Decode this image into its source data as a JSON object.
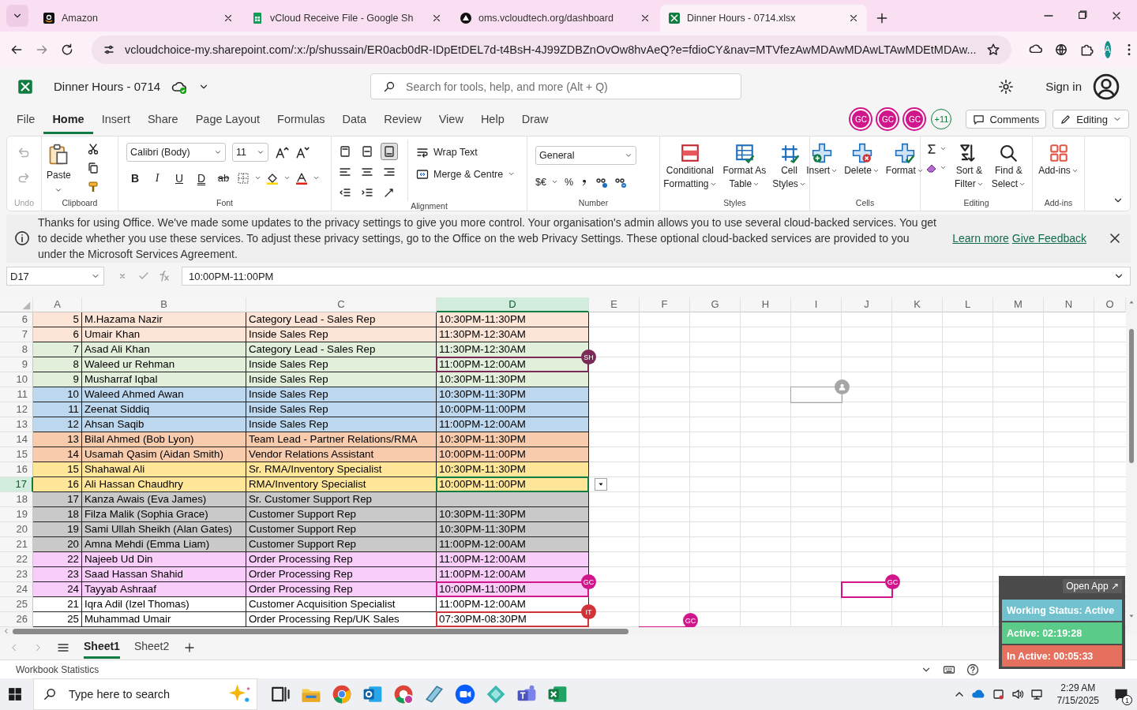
{
  "browser": {
    "tabs": [
      {
        "title": "Amazon",
        "kind": "amazon",
        "selected": false
      },
      {
        "title": "vCloud Receive File - Google Sh",
        "kind": "sheets",
        "selected": false
      },
      {
        "title": "oms.vcloudtech.org/dashboard",
        "kind": "triangle",
        "selected": false
      },
      {
        "title": "Dinner Hours - 0714.xlsx",
        "kind": "excel",
        "selected": true
      }
    ],
    "url": "vcloudchoice-my.sharepoint.com/:x:/p/shussain/ER0acb0dR-IDpEtDEL7d-t4BsH-4J99ZDBZnOvOw8hvAeQ?e=fdioCY&nav=MTVfezAwMDAwMDAwLTAwMDEtMDAw...",
    "profile": "A"
  },
  "app": {
    "title": "Dinner Hours - 0714",
    "search_placeholder": "Search for tools, help, and more (Alt + Q)",
    "sign_in": "Sign in"
  },
  "menu": [
    {
      "label": "File",
      "selected": false
    },
    {
      "label": "Home",
      "selected": true
    },
    {
      "label": "Insert",
      "selected": false
    },
    {
      "label": "Share",
      "selected": false
    },
    {
      "label": "Page Layout",
      "selected": false
    },
    {
      "label": "Formulas",
      "selected": false
    },
    {
      "label": "Data",
      "selected": false
    },
    {
      "label": "Review",
      "selected": false
    },
    {
      "label": "View",
      "selected": false
    },
    {
      "label": "Help",
      "selected": false
    },
    {
      "label": "Draw",
      "selected": false
    }
  ],
  "collaborators": [
    {
      "initials": "GC",
      "color": "#d1168c"
    },
    {
      "initials": "GC",
      "color": "#d1168c"
    },
    {
      "initials": "GC",
      "color": "#d1168c"
    }
  ],
  "more_collaborators": "+11",
  "comments": "Comments",
  "mode": "Editing",
  "ribbon": [
    {
      "kind": "undo",
      "label": "Undo",
      "disabled": true
    },
    {
      "kind": "clipboard",
      "label": "Clipboard",
      "paste": "Paste"
    },
    {
      "kind": "font",
      "label": "Font",
      "font": "Calibri (Body)",
      "size": "11",
      "styles": [
        {
          "text": "B",
          "kind": "bold"
        },
        {
          "text": "I",
          "kind": "italic"
        },
        {
          "text": "U",
          "kind": "underline"
        },
        {
          "text": "D",
          "kind": "double"
        },
        {
          "text": "ab",
          "kind": "strike"
        }
      ]
    },
    {
      "kind": "alignment",
      "label": "Alignment",
      "wrap": "Wrap Text",
      "merge": "Merge & Centre"
    },
    {
      "kind": "number",
      "label": "Number",
      "format": "General",
      "currency": "$€",
      "percent": "%"
    },
    {
      "kind": "large",
      "label": "Styles",
      "buttons": [
        {
          "lines": [
            "Conditional",
            "Formatting"
          ],
          "kind": "conditional"
        },
        {
          "lines": [
            "Format As",
            "Table"
          ],
          "kind": "table"
        },
        {
          "lines": [
            "Cell",
            "Styles"
          ],
          "kind": "cellstyles"
        }
      ]
    },
    {
      "kind": "large",
      "label": "Cells",
      "buttons": [
        {
          "lines": [
            "Insert"
          ],
          "kind": "insert"
        },
        {
          "lines": [
            "Delete"
          ],
          "kind": "delete"
        },
        {
          "lines": [
            "Format"
          ],
          "kind": "format"
        }
      ]
    },
    {
      "kind": "editing",
      "label": "Editing",
      "buttons": [
        {
          "lines": [
            "Sort &",
            "Filter"
          ],
          "kind": "sort"
        },
        {
          "lines": [
            "Find &",
            "Select"
          ],
          "kind": "find"
        }
      ]
    },
    {
      "kind": "large",
      "label": "Add-ins",
      "buttons": [
        {
          "lines": [
            "Add-ins"
          ],
          "kind": "addins"
        }
      ]
    }
  ],
  "notice": {
    "text": "Thanks for using Office. We've made some updates to the privacy settings to give you more control. Your organisation's admin allows you to use several cloud-backed services. You get to decide whether you use these services. To adjust these privacy settings, go to the Office on the web Privacy Settings. These optional cloud-backed services are provided to you under the Microsoft Services Agreement.",
    "links": [
      "Learn more",
      "Give Feedback"
    ]
  },
  "formula_bar": {
    "name_box": "D17",
    "formula": "10:00PM-11:00PM"
  },
  "sheet": {
    "columns": [
      {
        "label": "A",
        "selected": false
      },
      {
        "label": "B",
        "selected": false
      },
      {
        "label": "C",
        "selected": false
      },
      {
        "label": "D",
        "selected": true
      },
      {
        "label": "E",
        "selected": false
      },
      {
        "label": "F",
        "selected": false
      },
      {
        "label": "G",
        "selected": false
      },
      {
        "label": "H",
        "selected": false
      },
      {
        "label": "I",
        "selected": false
      },
      {
        "label": "J",
        "selected": false
      },
      {
        "label": "K",
        "selected": false
      },
      {
        "label": "L",
        "selected": false
      },
      {
        "label": "M",
        "selected": false
      },
      {
        "label": "N",
        "selected": false
      },
      {
        "label": "O",
        "selected": false
      }
    ],
    "rows": [
      {
        "number": "6",
        "color": "#fce4d6",
        "selected": false,
        "cells": [
          "5",
          "M.Hazama Nazir",
          "Category Lead - Sales Rep",
          "10:30PM-11:30PM"
        ]
      },
      {
        "number": "7",
        "color": "#fce4d6",
        "selected": false,
        "cells": [
          "6",
          "Umair Khan",
          "Inside Sales Rep",
          "11:30PM-12:30AM"
        ]
      },
      {
        "number": "8",
        "color": "#e2efda",
        "selected": false,
        "cells": [
          "7",
          "Asad Ali Khan",
          "Category Lead - Sales Rep",
          "11:30PM-12:30AM"
        ]
      },
      {
        "number": "9",
        "color": "#e2efda",
        "selected": false,
        "cells": [
          "8",
          "Waleed ur Rehman",
          "Inside Sales Rep",
          "11:00PM-12:00AM"
        ]
      },
      {
        "number": "10",
        "color": "#e2efda",
        "selected": false,
        "cells": [
          "9",
          "Musharraf Iqbal",
          "Inside Sales Rep",
          "10:30PM-11:30PM"
        ]
      },
      {
        "number": "11",
        "color": "#bdd7ee",
        "selected": false,
        "cells": [
          "10",
          "Waleed Ahmed Awan",
          "Inside Sales Rep",
          "10:30PM-11:30PM"
        ]
      },
      {
        "number": "12",
        "color": "#bdd7ee",
        "selected": false,
        "cells": [
          "11",
          "Zeenat Siddiq",
          "Inside Sales Rep",
          "10:00PM-11:00PM"
        ]
      },
      {
        "number": "13",
        "color": "#bdd7ee",
        "selected": false,
        "cells": [
          "12",
          "Ahsan Saqib",
          "Inside Sales Rep",
          "11:00PM-12:00AM"
        ]
      },
      {
        "number": "14",
        "color": "#f8cbad",
        "selected": false,
        "cells": [
          "13",
          "Bilal Ahmed (Bob Lyon)",
          "Team Lead - Partner Relations/RMA",
          "10:30PM-11:30PM"
        ]
      },
      {
        "number": "15",
        "color": "#f8cbad",
        "selected": false,
        "cells": [
          "14",
          "Usamah Qasim (Aidan Smith)",
          "Vendor Relations Assistant",
          "10:00PM-11:00PM"
        ]
      },
      {
        "number": "16",
        "color": "#ffe699",
        "selected": false,
        "cells": [
          "15",
          "Shahawal Ali",
          "Sr. RMA/Inventory Specialist",
          "10:30PM-11:30PM"
        ]
      },
      {
        "number": "17",
        "color": "#ffe699",
        "selected": true,
        "cells": [
          "16",
          "Ali Hassan Chaudhry",
          "RMA/Inventory Specialist",
          "10:00PM-11:00PM"
        ]
      },
      {
        "number": "18",
        "color": "#c9c9c9",
        "selected": false,
        "cells": [
          "17",
          "Kanza Awais (Eva James)",
          "Sr. Customer Support Rep"
        ]
      },
      {
        "number": "19",
        "color": "#c9c9c9",
        "selected": false,
        "cells": [
          "18",
          "Filza Malik (Sophia Grace)",
          "Customer Support Rep",
          "10:30PM-11:30PM"
        ]
      },
      {
        "number": "20",
        "color": "#c9c9c9",
        "selected": false,
        "cells": [
          "19",
          "Sami Ullah Sheikh (Alan Gates)",
          "Customer Support Rep",
          "10:30PM-11:30PM"
        ]
      },
      {
        "number": "21",
        "color": "#c9c9c9",
        "selected": false,
        "cells": [
          "20",
          "Amna Mehdi (Emma Liam)",
          "Customer Support Rep",
          "11:00PM-12:00AM"
        ]
      },
      {
        "number": "22",
        "color": "#f9cdf9",
        "selected": false,
        "cells": [
          "22",
          "Najeeb Ud Din",
          "Order Processing Rep",
          "11:00PM-12:00AM"
        ]
      },
      {
        "number": "23",
        "color": "#f9cdf9",
        "selected": false,
        "cells": [
          "23",
          "Saad Hassan Shahid",
          "Order Processing Rep",
          "11:00PM-12:00AM"
        ]
      },
      {
        "number": "24",
        "color": "#f9cdf9",
        "selected": false,
        "cells": [
          "24",
          "Tayyab Ashraaf",
          "Order Processing Rep",
          "10:00PM-11:00PM"
        ]
      },
      {
        "number": "25",
        "color": "#ffffff",
        "selected": false,
        "cells": [
          "21",
          "Iqra Adil (Izel Thomas)",
          "Customer Acquisition Specialist",
          "11:00PM-12:00AM"
        ]
      },
      {
        "number": "26",
        "color": "#ffffff",
        "selected": false,
        "cells": [
          "25",
          "Muhammad Umair",
          "Order Processing Rep/UK Sales",
          "07:30PM-08:30PM"
        ]
      }
    ],
    "presence": [
      {
        "kind": "cell",
        "initials": "SH",
        "color": "#7b2a58"
      },
      {
        "kind": "anonymous",
        "color": "#a6a6a6"
      },
      {
        "kind": "cell",
        "initials": "GC",
        "color": "#d1168c"
      },
      {
        "kind": "cell",
        "initials": "GC",
        "color": "#d1168c"
      },
      {
        "kind": "cell",
        "initials": "IT",
        "color": "#d13438"
      },
      {
        "kind": "edge",
        "initials": "GC",
        "color": "#d1168c"
      }
    ]
  },
  "sheet_tabs": [
    {
      "label": "Sheet1",
      "selected": true
    },
    {
      "label": "Sheet2",
      "selected": false
    }
  ],
  "status_bar": {
    "text": "Workbook Statistics"
  },
  "tracker": {
    "open_app": "Open App ↗",
    "items": [
      {
        "text": "Working Status: Active",
        "color": "#72c1cf"
      },
      {
        "text": "Active: 02:19:28",
        "color": "#5acb89"
      },
      {
        "text": "In Active: 00:05:33",
        "color": "#e5705e"
      }
    ]
  },
  "taskbar": {
    "search_placeholder": "Type here to search",
    "time": "2:29 AM",
    "date": "7/15/2025",
    "notifications": "1"
  }
}
